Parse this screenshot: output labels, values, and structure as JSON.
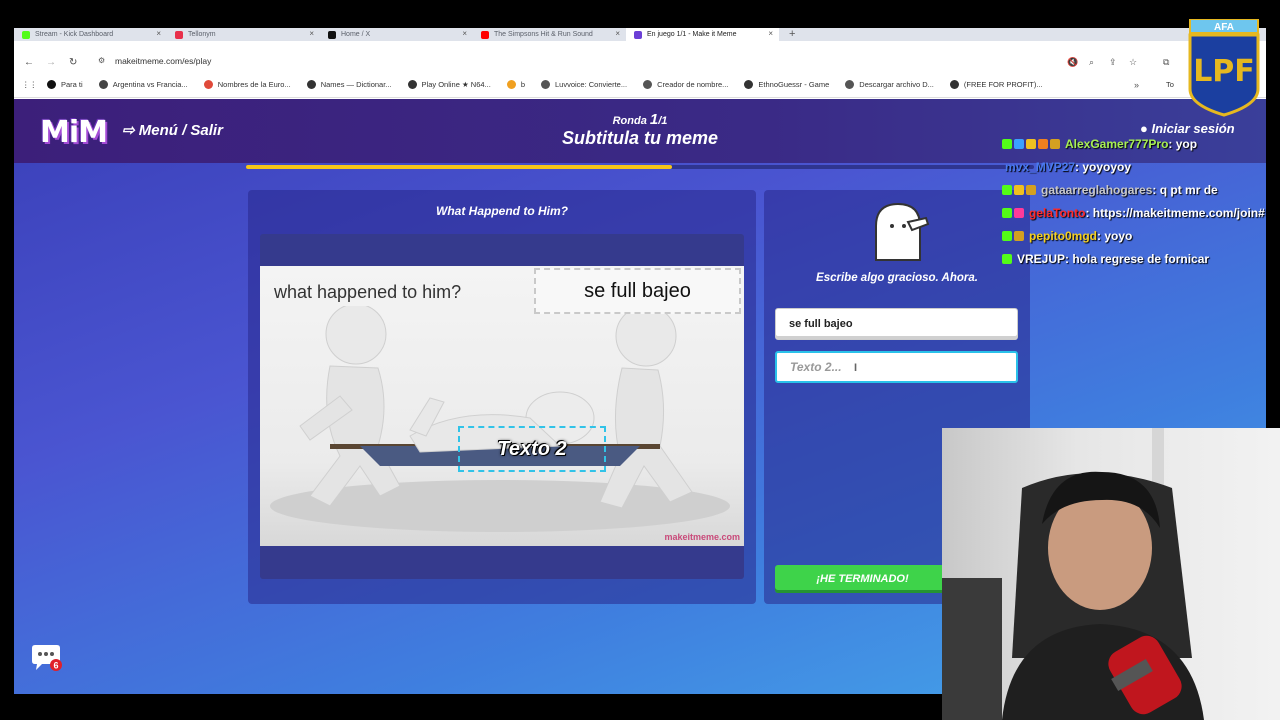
{
  "browser": {
    "tabs": [
      {
        "title": "Stream - Kick Dashboard",
        "color": "#53fc18"
      },
      {
        "title": "Tellonym",
        "color": "#e8304a"
      },
      {
        "title": "Home / X",
        "color": "#111111"
      },
      {
        "title": "The Simpsons Hit & Run Sound",
        "color": "#ff0000"
      },
      {
        "title": "En juego 1/1 - Make it Meme",
        "color": "#6b3fd6",
        "active": true
      }
    ],
    "url": "makeitmeme.com/es/play",
    "bookmarks": [
      {
        "label": "Para ti",
        "color": "#111111"
      },
      {
        "label": "Argentina vs Francia...",
        "color": "#444444"
      },
      {
        "label": "Nombres de la Euro...",
        "color": "#e04a3a"
      },
      {
        "label": "Names — Dictionar...",
        "color": "#333333"
      },
      {
        "label": "Play Online ★ N64...",
        "color": "#333333"
      },
      {
        "label": "b",
        "color": "#f0a020"
      },
      {
        "label": "Luvvoice: Convierte...",
        "color": "#555555"
      },
      {
        "label": "Creador de nombre...",
        "color": "#555555"
      },
      {
        "label": "EthnoGuessr - Game",
        "color": "#333333"
      },
      {
        "label": "Descargar archivo D...",
        "color": "#555555"
      },
      {
        "label": "(FREE FOR PROFIT)...",
        "color": "#333333"
      }
    ],
    "bookmarks_more": "»",
    "bookmarks_folder": "To"
  },
  "game": {
    "logo": "MiM",
    "menu_link": "⇨ Menú / Salir",
    "round_prefix": "Ronda ",
    "round_current": "1",
    "round_total": "/1",
    "title": "Subtitula tu meme",
    "login": "Iniciar sesión",
    "progress": 0.54,
    "meme": {
      "title": "What Happend to Him?",
      "caption": "what happened to him?",
      "text_box_1": "se full bajeo",
      "text_box_2": "Texto 2",
      "watermark": "makeitmeme.com"
    },
    "instruction": "Escribe algo gracioso. Ahora.",
    "input_1_value": "se full bajeo",
    "input_2_placeholder": "Texto 2...",
    "done_button": "¡HE TERMINADO!",
    "chat_badge_count": "6"
  },
  "chat": [
    {
      "user": "AlexGamer777Pro",
      "color": "#a7f052",
      "msg": " : yop",
      "badges": [
        "#53fc18",
        "#3aa0ff",
        "#f0c020",
        "#f08020",
        "#d4a020"
      ]
    },
    {
      "user": "mvx_MVP27",
      "color": "#4a7af0",
      "msg": " : yoyoyoy",
      "badges": []
    },
    {
      "user": "gataarreglahogares",
      "color": "#c9c9c9",
      "msg": " : q pt mr de ",
      "badges": [
        "#53fc18",
        "#f0c020",
        "#d4a020"
      ]
    },
    {
      "user": "gelaTonto",
      "color": "#ff2a2a",
      "msg": " : https://makeitmeme.com/join#",
      "badges": [
        "#53fc18",
        "#ff3a9a"
      ]
    },
    {
      "user": "pepito0mgd",
      "color": "#f5d020",
      "msg": " : yoyo",
      "badges": [
        "#53fc18",
        "#d4a020"
      ]
    },
    {
      "user": "VREJUP",
      "color": "#ffffff",
      "msg": " : hola regrese de fornicar",
      "badges": [
        "#53fc18"
      ]
    }
  ],
  "crest_text": "AFA",
  "crest_letters": "LPF"
}
